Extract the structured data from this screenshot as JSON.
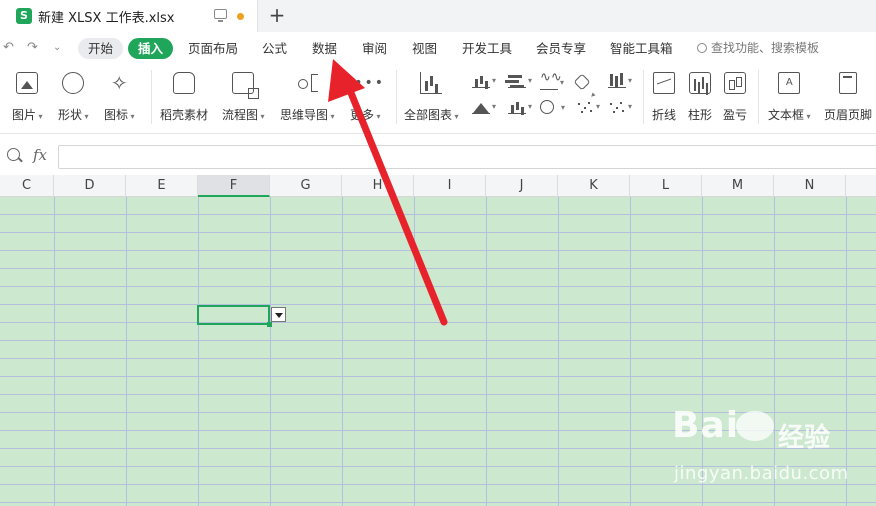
{
  "app": {
    "document_title": "新建 XLSX 工作表.xlsx",
    "app_icon_glyph": "S",
    "new_tab_symbol": "+",
    "brand_color": "#1fa65a",
    "grid_color": "#cce8cf",
    "unsaved_dot_color": "#f0a020"
  },
  "menubar": {
    "items": [
      {
        "label": "开始"
      },
      {
        "label": "插入"
      },
      {
        "label": "页面布局"
      },
      {
        "label": "公式"
      },
      {
        "label": "数据"
      },
      {
        "label": "审阅"
      },
      {
        "label": "视图"
      },
      {
        "label": "开发工具"
      },
      {
        "label": "会员专享"
      },
      {
        "label": "智能工具箱"
      }
    ],
    "active_item": "插入",
    "search_placeholder": "查找功能、搜索模板"
  },
  "ribbon": {
    "items": [
      {
        "label": "图片",
        "icon": "picture-icon"
      },
      {
        "label": "形状",
        "icon": "shape-icon"
      },
      {
        "label": "图标",
        "icon": "icons-icon"
      },
      {
        "label": "稻壳素材",
        "icon": "docer-icon"
      },
      {
        "label": "流程图",
        "icon": "flowchart-icon"
      },
      {
        "label": "思维导图",
        "icon": "mindmap-icon"
      },
      {
        "label": "更多",
        "icon": "more-icon"
      },
      {
        "label": "全部图表",
        "icon": "all-charts-icon"
      },
      {
        "label": "折线",
        "icon": "line-chart-icon"
      },
      {
        "label": "柱形",
        "icon": "column-chart-icon"
      },
      {
        "label": "盈亏",
        "icon": "winloss-chart-icon"
      },
      {
        "label": "文本框",
        "icon": "textbox-icon"
      },
      {
        "label": "页眉页脚",
        "icon": "header-footer-icon"
      }
    ]
  },
  "formula": {
    "fx_label": "fx",
    "value": ""
  },
  "grid": {
    "columns": [
      "C",
      "D",
      "E",
      "F",
      "G",
      "H",
      "I",
      "J",
      "K",
      "L",
      "M",
      "N"
    ],
    "selected_column": "F"
  },
  "watermark": {
    "brand": "Bai",
    "brand_cn": "经验",
    "url": "jingyan.baidu.com"
  }
}
